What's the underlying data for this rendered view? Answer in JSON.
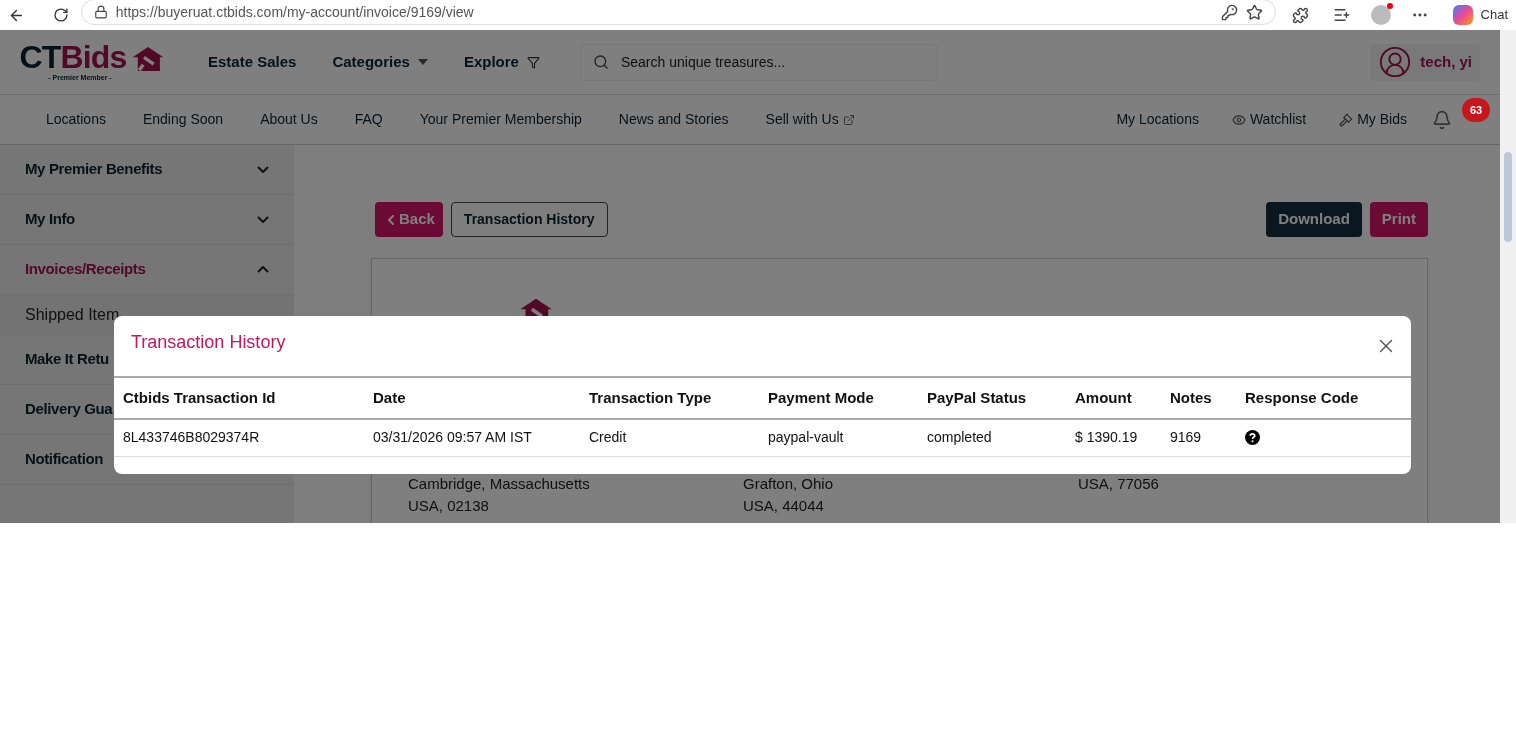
{
  "browser": {
    "url": "https://buyeruat.ctbids.com/my-account/invoice/9169/view",
    "chat": "Chat"
  },
  "header": {
    "logo": {
      "prefix": "CT",
      "suffix": "Bids",
      "tagline": "- Premier Member -"
    },
    "nav": [
      {
        "label": "Estate Sales",
        "kind": "plain"
      },
      {
        "label": "Categories",
        "kind": "dropdown"
      },
      {
        "label": "Explore",
        "kind": "filter"
      }
    ],
    "search": {
      "placeholder": "Search unique treasures..."
    },
    "user": "tech, yi"
  },
  "subnav": {
    "left": [
      {
        "label": "Locations",
        "kind": "plain"
      },
      {
        "label": "Ending Soon",
        "kind": "plain"
      },
      {
        "label": "About Us",
        "kind": "plain"
      },
      {
        "label": "FAQ",
        "kind": "plain"
      },
      {
        "label": "Your Premier Membership",
        "kind": "plain"
      },
      {
        "label": "News and Stories",
        "kind": "plain"
      },
      {
        "label": "Sell with Us",
        "kind": "external"
      }
    ],
    "right": [
      {
        "label": "My Locations",
        "kind": "plain"
      },
      {
        "label": "Watchlist",
        "kind": "eye"
      },
      {
        "label": "My Bids",
        "kind": "gavel"
      }
    ],
    "notifications": "63"
  },
  "sidebar": [
    {
      "label": "My Premier Benefits",
      "kind": "section",
      "expanded": false,
      "selected": false
    },
    {
      "label": "My Info",
      "kind": "section",
      "expanded": false,
      "selected": false
    },
    {
      "label": "Invoices/Receipts",
      "kind": "section",
      "expanded": true,
      "selected": true,
      "children": [
        {
          "label": "Shipped Item"
        }
      ]
    },
    {
      "label": "Make It Retu",
      "kind": "link"
    },
    {
      "label": "Delivery Gua",
      "kind": "link"
    },
    {
      "label": "Notification",
      "kind": "link"
    }
  ],
  "toolbar": {
    "back": "Back",
    "history": "Transaction History",
    "download": "Download",
    "print": "Print"
  },
  "invoice": {
    "addresses": [
      [
        "Cambridge, Massachusetts",
        "USA, 02138"
      ],
      [
        "Grafton, Ohio",
        "USA, 44044"
      ],
      [
        "USA, 77056"
      ]
    ]
  },
  "modal": {
    "title": "Transaction History",
    "columns": [
      "Ctbids Transaction Id",
      "Date",
      "Transaction Type",
      "Payment Mode",
      "PayPal Status",
      "Amount",
      "Notes",
      "Response Code"
    ],
    "rows": [
      {
        "cells": [
          "8L433746B8029374R",
          "03/31/2026 09:57 AM IST",
          "Credit",
          "paypal-vault",
          "completed",
          "$ 1390.19",
          "9169"
        ],
        "kind": "question"
      }
    ]
  }
}
